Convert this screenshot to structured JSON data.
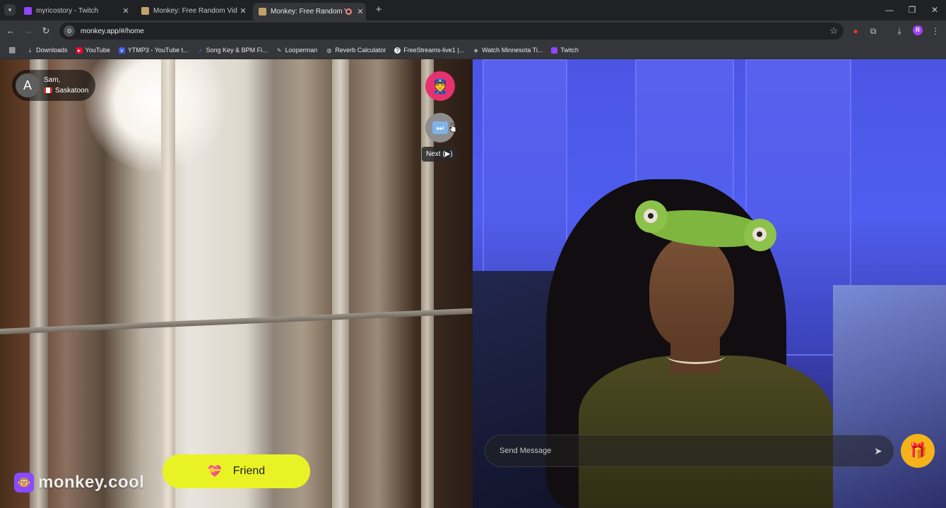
{
  "browser": {
    "tabs": [
      {
        "title": "myricostory - Twitch",
        "favicon_color": "#9146ff",
        "active": false
      },
      {
        "title": "Monkey: Free Random Video Ch",
        "favicon_color": "#c4a06a",
        "active": false
      },
      {
        "title": "Monkey: Free Random Video",
        "favicon_color": "#c4a06a",
        "active": true
      }
    ],
    "url": "monkey.app/#/home",
    "bookmarks": [
      {
        "label": "Downloads",
        "icon": "download-icon",
        "color": "#c4c7c5"
      },
      {
        "label": "YouTube",
        "icon": "youtube-icon",
        "color": "#ff0033"
      },
      {
        "label": "YTMP3 - YouTube t...",
        "icon": "ytmp3-icon",
        "color": "#3b5bdb"
      },
      {
        "label": "Song Key & BPM Fi...",
        "icon": "music-icon",
        "color": "#5c7cfa"
      },
      {
        "label": "Looperman",
        "icon": "looperman-icon",
        "color": "#c4c7c5"
      },
      {
        "label": "Reverb Calculator",
        "icon": "reverb-icon",
        "color": "#c4c7c5"
      },
      {
        "label": "FreeStreams-live1 |...",
        "icon": "freestreams-icon",
        "color": "#e8eaed"
      },
      {
        "label": "Watch Minnesota Ti...",
        "icon": "watch-icon",
        "color": "#c4c7c5"
      },
      {
        "label": "Twitch",
        "icon": "twitch-icon",
        "color": "#9146ff"
      }
    ],
    "profile_initial": "R"
  },
  "app": {
    "peer": {
      "avatar_initial": "A",
      "name": "Sam,",
      "location": "Saskatoon"
    },
    "next_tooltip": "Next (▶)",
    "friend_label": "Friend",
    "brand": "monkey.cool",
    "message_placeholder": "Send Message"
  },
  "colors": {
    "friend_button": "#e9f225",
    "report_button": "#e8316f",
    "gift_button": "#f5b31a",
    "brand_icon": "#8a4bff"
  }
}
